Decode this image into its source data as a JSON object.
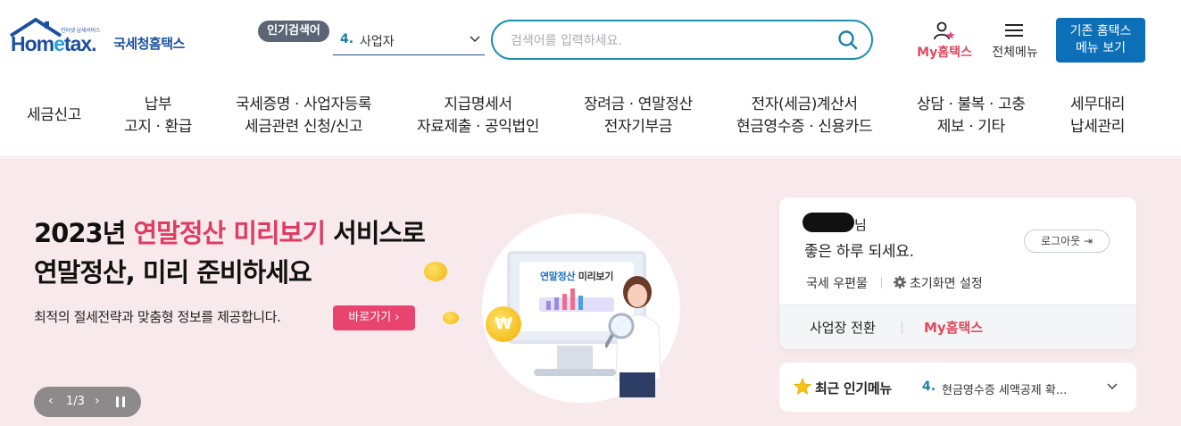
{
  "logo": {
    "small": "인터넷 납세서비스",
    "word_a": "Hom",
    "word_e": "e",
    "word_b": "tax.",
    "kr": "국세청홈택스"
  },
  "popular": {
    "badge": "인기검색어",
    "num": "4.",
    "text": "사업자"
  },
  "search": {
    "placeholder": "검색어를 입력하세요."
  },
  "utility": {
    "my": "My홈택스",
    "all_menu": "전체메뉴",
    "old_menu_1": "기존 홈택스",
    "old_menu_2": "메뉴 보기"
  },
  "gnb": [
    {
      "l1": "세금신고",
      "l2": ""
    },
    {
      "l1": "납부",
      "l2": "고지 · 환급"
    },
    {
      "l1": "국세증명 · 사업자등록",
      "l2": "세금관련 신청/신고"
    },
    {
      "l1": "지급명세서",
      "l2": "자료제출 · 공익법인"
    },
    {
      "l1": "장려금 · 연말정산",
      "l2": "전자기부금"
    },
    {
      "l1": "전자(세금)계산서",
      "l2": "현금영수증 · 신용카드"
    },
    {
      "l1": "상담 · 불복 · 고충",
      "l2": "제보 · 기타"
    },
    {
      "l1": "세무대리",
      "l2": "납세관리"
    }
  ],
  "banner": {
    "line1_a": "2023년 ",
    "line1_hl": "연말정산 미리보기",
    "line1_b": " 서비스로",
    "line2": "연말정산, 미리 준비하세요",
    "sub": "최적의 절세전략과 맞춤형 정보를 제공합니다.",
    "go": "바로가기 ›",
    "monitor_a": "연말정산",
    "monitor_b": " 미리보기",
    "won": "₩"
  },
  "slider": {
    "prev": "‹",
    "count": "1/3",
    "next": "›"
  },
  "user": {
    "name_suffix": "님",
    "greeting": "좋은 하루 되세요.",
    "logout": "로그아웃 ⇥",
    "mail": "국세 우편물",
    "settings": "초기화면 설정",
    "switch": "사업장 전환",
    "my": "My홈택스"
  },
  "recent": {
    "label": "최근 인기메뉴",
    "num": "4.",
    "text": "현금영수증 세액공제 확..."
  },
  "colors": {
    "accent": "#1d8fb0",
    "brand": "#1b4fa0",
    "highlight": "#e03b63",
    "banner_bg": "#f8eaec"
  }
}
